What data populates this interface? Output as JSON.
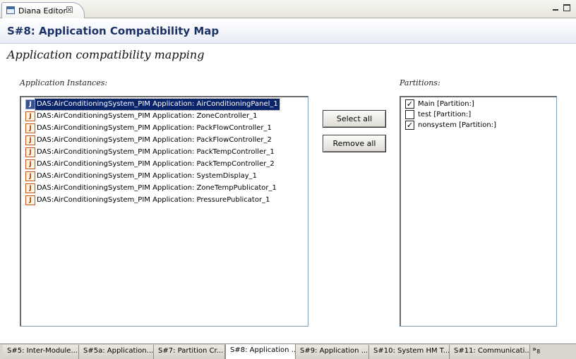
{
  "view_tab": {
    "label": "Diana Editor",
    "close": "☒"
  },
  "form": {
    "title": "S#8: Application Compatibility Map",
    "section_title": "Application compatibility mapping"
  },
  "apps": {
    "label": "Application Instances:",
    "items": [
      "DAS:AirConditioningSystem_PIM  Application: AirConditioningPanel_1",
      "DAS:AirConditioningSystem_PIM  Application: ZoneController_1",
      "DAS:AirConditioningSystem_PIM  Application: PackFlowController_1",
      "DAS:AirConditioningSystem_PIM  Application: PackFlowController_2",
      "DAS:AirConditioningSystem_PIM  Application: PackTempController_1",
      "DAS:AirConditioningSystem_PIM  Application: PackTempController_2",
      "DAS:AirConditioningSystem_PIM  Application: SystemDisplay_1",
      "DAS:AirConditioningSystem_PIM  Application: ZoneTempPublicator_1",
      "DAS:AirConditioningSystem_PIM  Application: PressurePublicator_1"
    ],
    "selected_index": 0,
    "icon": "J"
  },
  "buttons": {
    "select_all": "Select all",
    "remove_all": "Remove all"
  },
  "partitions": {
    "label": "Partitions:",
    "items": [
      {
        "label": "Main [Partition:]",
        "checked": true
      },
      {
        "label": "test [Partition:]",
        "checked": false
      },
      {
        "label": "nonsystem [Partition:]",
        "checked": true
      }
    ]
  },
  "page_tabs": [
    "S#5: Inter-Module...",
    "S#5a: Application...",
    "S#7: Partition Cr...",
    "S#8: Application ...",
    "S#9: Application ...",
    "S#10: System HM T...",
    "S#11: Communicati..."
  ],
  "active_page_tab": 3,
  "overflow": {
    "glyph": "»",
    "count": "8"
  },
  "colors": {
    "title": "#1a3266",
    "selection": "#0a246a"
  }
}
